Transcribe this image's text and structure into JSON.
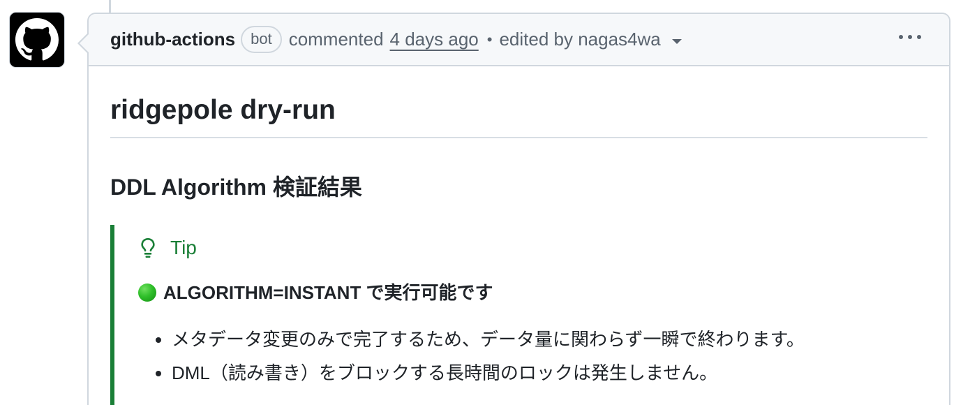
{
  "comment": {
    "author": "github-actions",
    "badge": "bot",
    "action": "commented",
    "time": "4 days ago",
    "separator": "•",
    "edited": "edited by nagas4wa"
  },
  "body": {
    "title": "ridgepole dry-run",
    "subtitle": "DDL Algorithm 検証結果",
    "tip": {
      "label": "Tip",
      "headline": "ALGORITHM=INSTANT で実行可能です",
      "bullets": [
        "メタデータ変更のみで完了するため、データ量に関わらず一瞬で終わります。",
        "DML（読み書き）をブロックする長時間のロックは発生しません。"
      ]
    }
  },
  "icons": {
    "avatar": "github-octocat-icon",
    "tip": "light-bulb-icon",
    "status": "green-circle-icon",
    "menu": "kebab-horizontal-icon",
    "edited_dropdown": "triangle-down-icon"
  },
  "colors": {
    "tip_accent": "#1a7f37",
    "border": "#d0d7de",
    "header_bg": "#f6f8fa",
    "muted_text": "#59636e"
  }
}
